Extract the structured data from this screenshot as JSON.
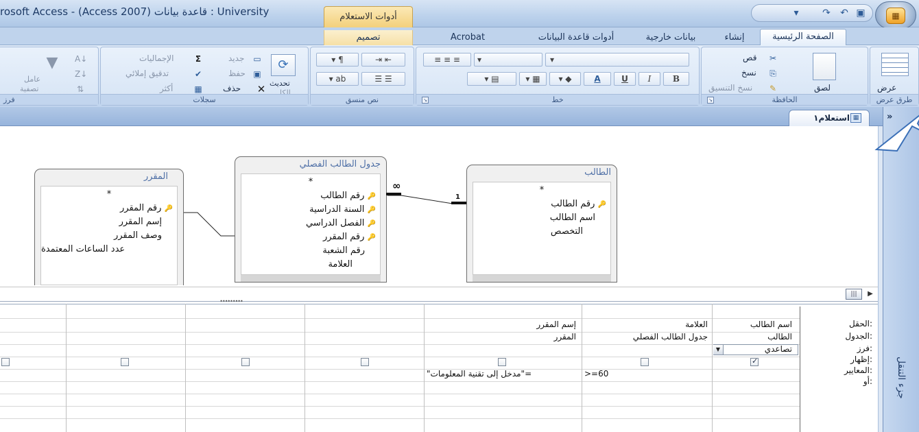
{
  "window": {
    "title": "rosoft Access - (Access 2007) قاعدة بيانات : University",
    "contextual_tab_title": "أدوات الاستعلام",
    "office_button_label": "",
    "qat_icons": [
      "save-icon",
      "undo-icon",
      "redo-icon",
      "customize-qat-icon"
    ]
  },
  "ribbon": {
    "tabs": [
      {
        "label": "الصفحة الرئيسية",
        "active": true
      },
      {
        "label": "إنشاء"
      },
      {
        "label": "بيانات خارجية"
      },
      {
        "label": "أدوات قاعدة البيانات"
      },
      {
        "label": "Acrobat"
      },
      {
        "label": "تصميم"
      }
    ],
    "groups": {
      "views": {
        "label": "طرق عرض",
        "view_button": "عرض"
      },
      "clipboard": {
        "label": "الحافظة",
        "paste": "لصق",
        "cut": "قص",
        "copy": "نسخ",
        "format_painter": "نسخ التنسيق"
      },
      "font": {
        "label": "خط",
        "bold": "B",
        "italic": "I",
        "underline": "U",
        "font_color": "A"
      },
      "rich_text": {
        "label": "نص منسق"
      },
      "records": {
        "label": "سجلات",
        "refresh_all_line1": "تحديث",
        "refresh_all_line2": "الكل",
        "new": "جديد",
        "save": "حفظ",
        "delete": "حذف",
        "totals": "الإجماليات",
        "spelling": "تدقيق إملائي",
        "more": "أكثر"
      },
      "sort_filter": {
        "label": "فرز",
        "filter_line1": "عامل",
        "filter_line2": "تصفية"
      }
    }
  },
  "document": {
    "tab_label": "استعلام١",
    "nav_collapse": "»",
    "nav_pane_label": "جزء التنقل"
  },
  "tables": [
    {
      "name": "الطالب",
      "fields": [
        {
          "name": "*",
          "key": false
        },
        {
          "name": "رقم الطالب",
          "key": true
        },
        {
          "name": "اسم الطالب",
          "key": false
        },
        {
          "name": "التخصص",
          "key": false
        }
      ]
    },
    {
      "name": "جدول الطالب الفصلي",
      "fields": [
        {
          "name": "*",
          "key": false
        },
        {
          "name": "رقم الطالب",
          "key": true
        },
        {
          "name": "السنة الدراسية",
          "key": true
        },
        {
          "name": "الفصل الدراسي",
          "key": true
        },
        {
          "name": "رقم المقرر",
          "key": true
        },
        {
          "name": "رقم الشعبة",
          "key": false
        },
        {
          "name": "العلامة",
          "key": false
        }
      ]
    },
    {
      "name": "المقرر",
      "fields": [
        {
          "name": "*",
          "key": false
        },
        {
          "name": "رقم المقرر",
          "key": true
        },
        {
          "name": "إسم المقرر",
          "key": false
        },
        {
          "name": "وصف المقرر",
          "key": false
        },
        {
          "name": "عدد الساعات المعتمدة",
          "key": false
        }
      ]
    }
  ],
  "relationships": [
    {
      "from": "الطالب",
      "to": "جدول الطالب الفصلي",
      "one_label": "1",
      "many_label": "∞"
    },
    {
      "from": "المقرر",
      "to": "جدول الطالب الفصلي"
    }
  ],
  "grid": {
    "row_labels": {
      "field": "الحقل:",
      "table": "الجدول:",
      "sort": "فرز:",
      "show": "إظهار:",
      "criteria": "المعايير:",
      "or": "أو:"
    },
    "columns": [
      {
        "field": "اسم الطالب",
        "table": "الطالب",
        "sort": "تصاعدي",
        "show": true,
        "criteria": ""
      },
      {
        "field": "العلامة",
        "table": "جدول الطالب الفصلي",
        "sort": "",
        "show": false,
        "criteria": ">=60"
      },
      {
        "field": "إسم المقرر",
        "table": "المقرر",
        "sort": "",
        "show": false,
        "criteria": "=\"مدخل إلى تقنية المعلومات\""
      },
      {
        "field": "",
        "table": "",
        "sort": "",
        "show": false,
        "criteria": ""
      },
      {
        "field": "",
        "table": "",
        "sort": "",
        "show": false,
        "criteria": ""
      },
      {
        "field": "",
        "table": "",
        "sort": "",
        "show": false,
        "criteria": ""
      },
      {
        "field": "",
        "table": "",
        "sort": "",
        "show": false,
        "criteria": ""
      }
    ]
  },
  "colors": {
    "ribbon": "#cfdff3",
    "title_bar": "#bcd2ec",
    "table_title": "#4e6fa6",
    "contextual_tab": "#f3cf7a"
  }
}
